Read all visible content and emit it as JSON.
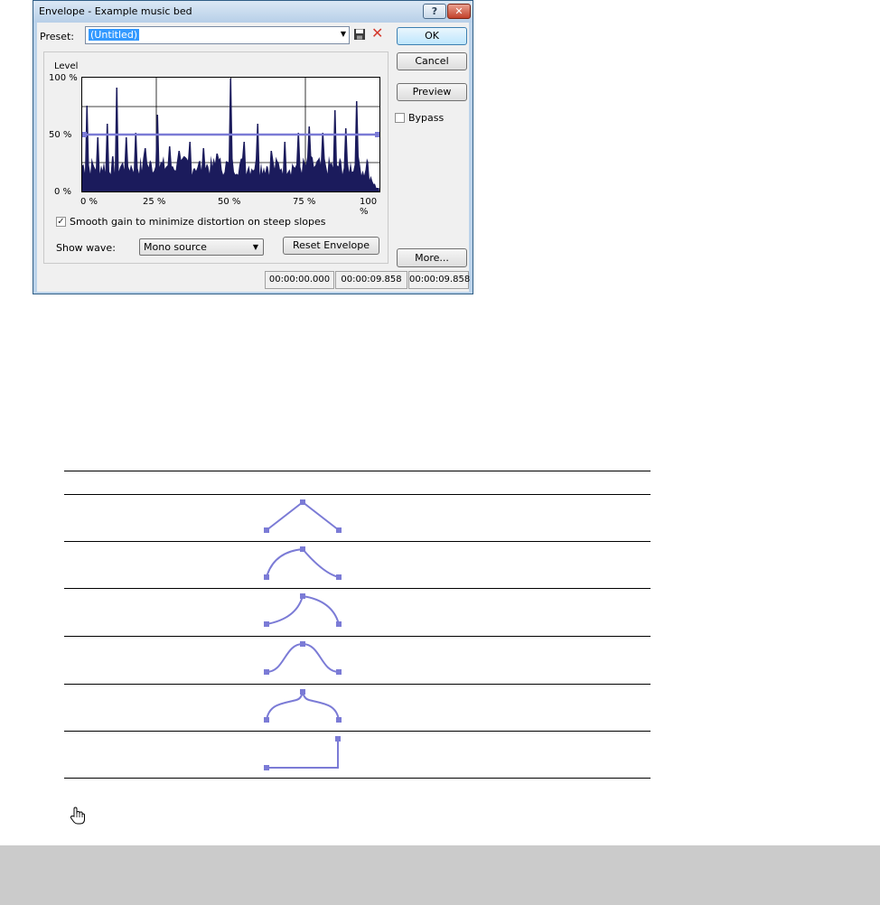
{
  "window": {
    "title": "Envelope - Example music bed",
    "help_glyph": "?",
    "close_glyph": "✕"
  },
  "preset": {
    "label": "Preset:",
    "value": "(Untitled)"
  },
  "buttons": {
    "ok": "OK",
    "cancel": "Cancel",
    "preview": "Preview",
    "more": "More...",
    "reset_envelope": "Reset Envelope"
  },
  "bypass": {
    "label": "Bypass",
    "checked": false
  },
  "graph": {
    "level_label": "Level",
    "y_ticks": [
      "100 %",
      "50 %",
      "0 %"
    ],
    "x_ticks": [
      "0 %",
      "25 %",
      "50 %",
      "75 %",
      "100 %"
    ],
    "envelope_level_percent": 50,
    "wave_color": "#1b1b5c",
    "envelope_color": "#7b7bd6"
  },
  "smooth": {
    "label": "Smooth gain to minimize distortion on steep slopes",
    "checked": true
  },
  "show_wave": {
    "label": "Show wave:",
    "value": "Mono source"
  },
  "status": [
    "00:00:00.000",
    "00:00:09.858",
    "00:00:09.858"
  ],
  "curves": [
    {
      "type": "linear"
    },
    {
      "type": "fast"
    },
    {
      "type": "slow"
    },
    {
      "type": "smooth"
    },
    {
      "type": "sharp"
    },
    {
      "type": "hold"
    }
  ],
  "accent": "#7b7bd6"
}
